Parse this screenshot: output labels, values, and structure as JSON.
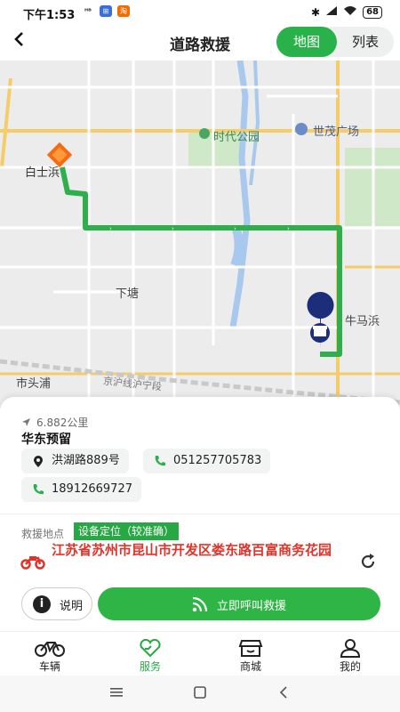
{
  "status_bar": {
    "time": "下午1:53",
    "battery": "68"
  },
  "header": {
    "back_icon": "back-arrow-icon",
    "title": "道路救援",
    "tab_map": "地图",
    "tab_list": "列表"
  },
  "map": {
    "labels": {
      "baishi": "白士浜",
      "shidai_park": "时代公园",
      "shimao": "世茂广场",
      "xiatang": "下塘",
      "niumabang": "牛马浜",
      "shitoupu": "市头浦",
      "railway": "京沪线沪宁段"
    },
    "route_color": "#2fae4e"
  },
  "card": {
    "distance": "6.882公里",
    "shop_name": "华东预留",
    "address_chip": "洪湖路889号",
    "phone1": "051257705783",
    "phone2": "18912669727",
    "location_label": "救援地点",
    "location_badge": "设备定位（较准确）",
    "address": "江苏省苏州市昆山市开发区娄东路百富商务花园",
    "info_button": "说明",
    "call_button": "立即呼叫救援"
  },
  "tabbar": {
    "vehicle": "车辆",
    "service": "服务",
    "mall": "商城",
    "mine": "我的",
    "active": "服务"
  },
  "colors": {
    "accent": "#29b24a",
    "address": "#e0342b"
  }
}
